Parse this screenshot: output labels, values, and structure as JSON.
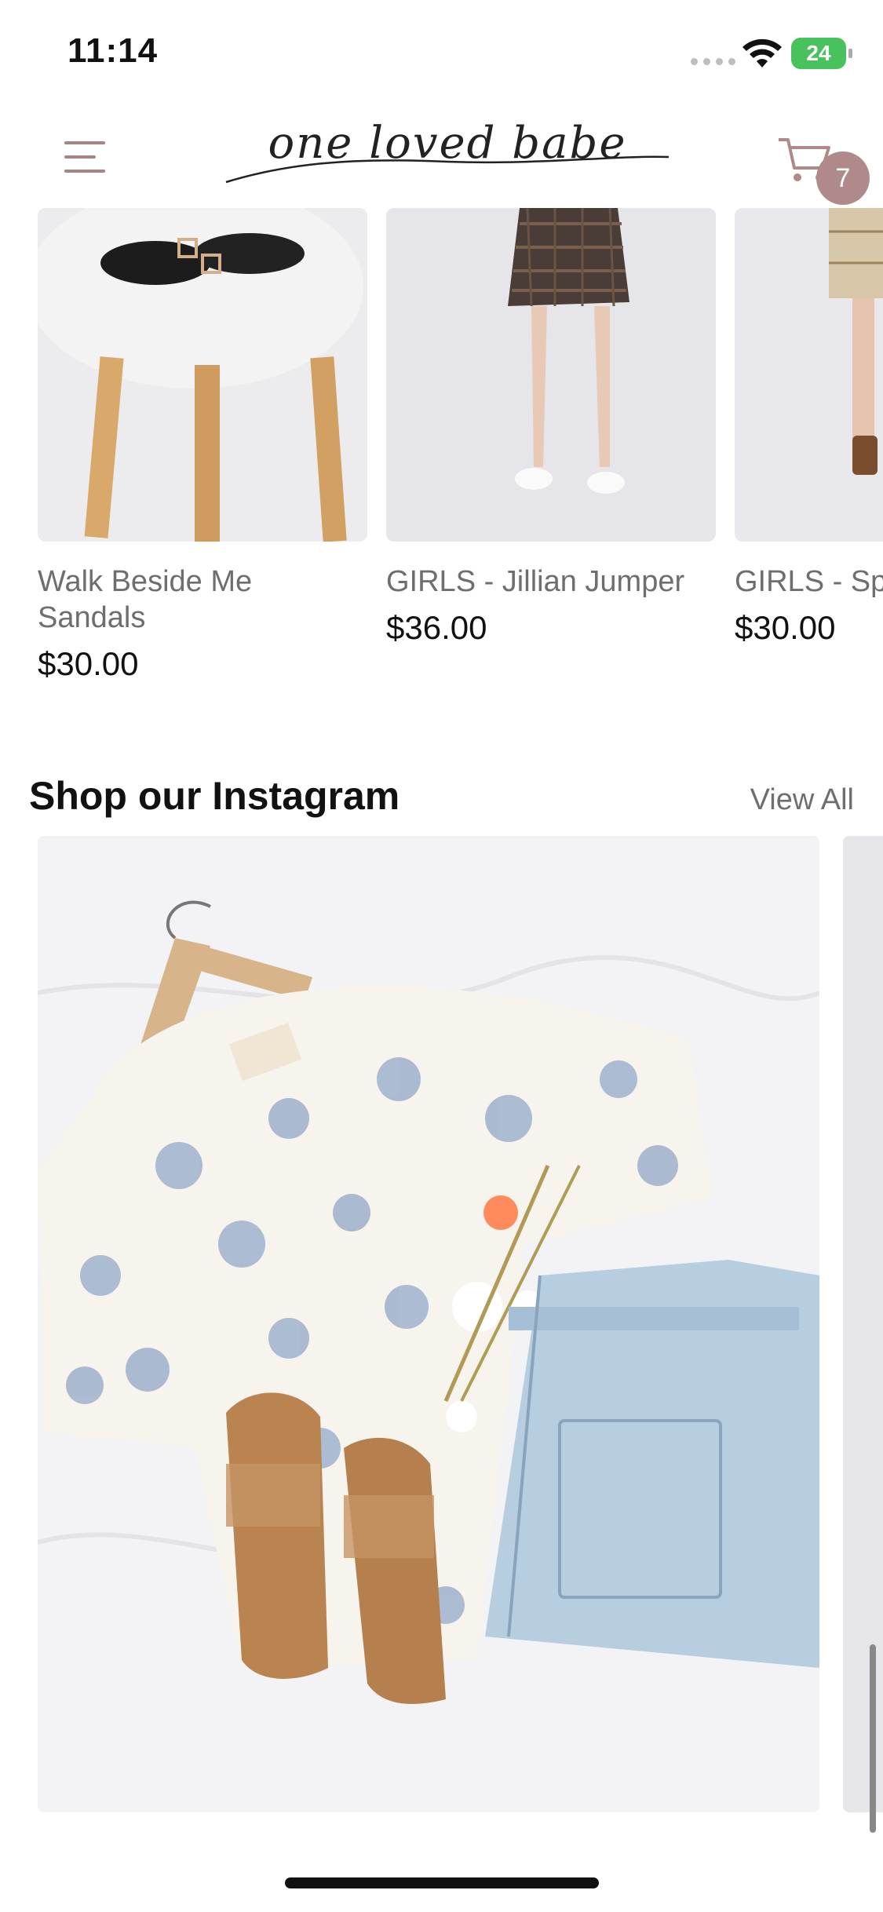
{
  "status_bar": {
    "time": "11:14",
    "battery": "24"
  },
  "header": {
    "logo": "one loved babe",
    "cart_count": "7"
  },
  "products": [
    {
      "name": "Walk Beside Me Sandals",
      "price": "$30.00"
    },
    {
      "name": "GIRLS - Jillian Jumper",
      "price": "$36.00"
    },
    {
      "name": "GIRLS - Sp",
      "price": "$30.00"
    }
  ],
  "instagram": {
    "title": "Shop our Instagram",
    "view_all": "View All"
  },
  "colors": {
    "accent": "#b08a8a",
    "menu": "#a98585",
    "battery": "#48c25c"
  }
}
